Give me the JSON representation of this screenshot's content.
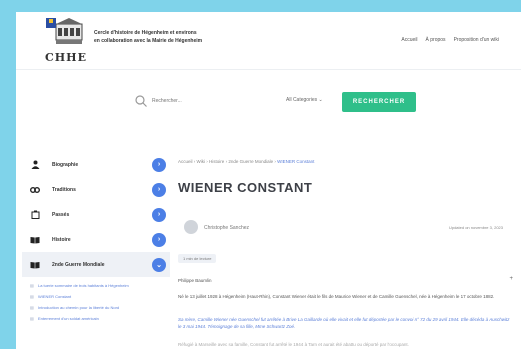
{
  "header": {
    "org_line1": "Cercle d'histoire de Hégenheim et environs",
    "org_line2": "en collaboration avec la Mairie de Hégenheim",
    "logo_text": "CHHE",
    "nav": [
      "Accueil",
      "À propos",
      "Proposition d'un wiki"
    ]
  },
  "search": {
    "placeholder": "Rechercher...",
    "category": "All Categories",
    "button": "RECHERCHER"
  },
  "sidebar": {
    "items": [
      {
        "label": "Biographie",
        "icon": "person-icon"
      },
      {
        "label": "Traditions",
        "icon": "chain-icon"
      },
      {
        "label": "Passés",
        "icon": "building-icon"
      },
      {
        "label": "Histoire",
        "icon": "book-icon"
      },
      {
        "label": "2nde Guerre Mondiale",
        "icon": "book-icon"
      }
    ],
    "subitems": [
      "La tuerie sommaire de trois habitants à Hégenheim",
      "WIENER Constant",
      "Introduction au chemin pour la liberté du Nord",
      "Enterrement d'un soldat américain"
    ]
  },
  "breadcrumb": [
    "Accueil",
    "Wiki",
    "Histoire",
    "2nde Guerre Mondiale",
    "WIENER Constant"
  ],
  "article": {
    "title": "WIENER CONSTANT",
    "author": "Christophe Sanchez",
    "updated": "Updated on novembre 3, 2023",
    "reading_time": "1 min de lecture",
    "paragraphs": [
      "Philippe Baumlin",
      "Né le 13 juillet 1928 à Hégenheim (Haut-Rhin), Constant Wiener était le fils de Maurice Wiener et de Camille Guenschel, née à Hégenheim le 17 octobre 1882.",
      "Sa mère, Camille Wiener née Guenschel fut arrêtée à Brive La Gaillarde où elle vivait et elle fut déportée par le convoi n° 72 du 29 avril 1944. Elle décéda à Auschwitz le 3 mai 1944. Témoignage de sa fille, Mme Schwartz Zoé.",
      "Réfugié à Marseille avec sa famille, Constant fut arrêté le 1944 à Tarn et aurait été abattu ou déporté par l'occupant."
    ]
  }
}
